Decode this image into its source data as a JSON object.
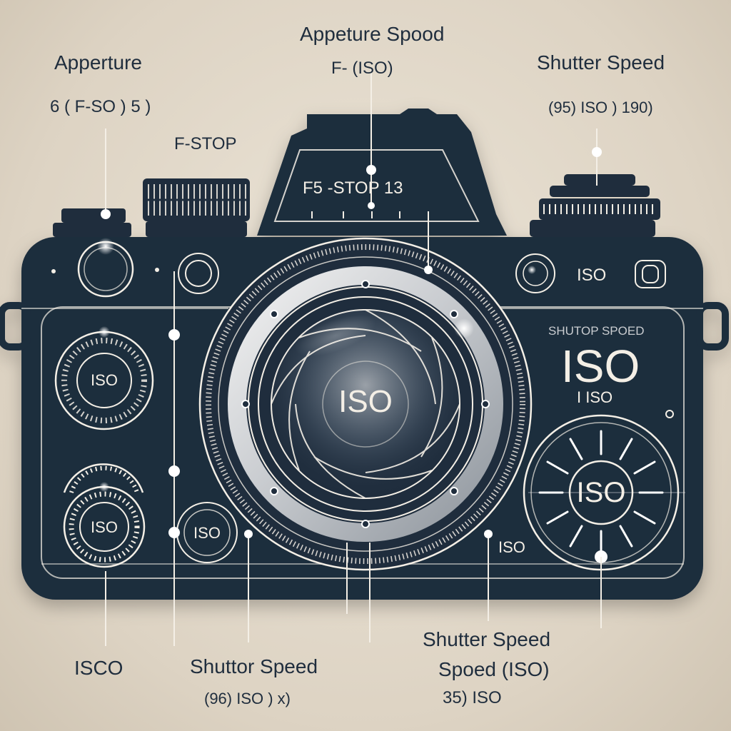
{
  "labels": {
    "aperture_title": "Apperture",
    "aperture_value": "6 ( F-SO ) 5 )",
    "fstop": "F-STOP",
    "top_title": "Appeture Spood",
    "top_sub": "F-   (ISO)",
    "shutter_title_tr": "Shutter Speed",
    "shutter_value_tr": "(95) ISO ) 190)",
    "prism_text": "F5 -STOP 13",
    "iso_right_small": "ISO",
    "right_panel_header": "SHUTOP SPOED",
    "right_panel_big": "ISO",
    "right_panel_sub": "I ISO",
    "left_dial_upper": "ISO",
    "left_dial_lower": "ISO",
    "small_dial": "ISO",
    "lens_center": "ISO",
    "right_dial": "ISO",
    "iso_near_lens": "ISO",
    "bottom_left": "ISCO",
    "bottom_mid_title": "Shuttor Speed",
    "bottom_mid_sub": "(96) ISO )   x)",
    "bottom_right_title": "Shutter Speed",
    "bottom_right_sub": "Spoed (ISO)",
    "bottom_right_sub2": "35) ISO"
  },
  "colors": {
    "body": "#1f2d3d",
    "line": "#f4efe6",
    "accent": "#ffffff",
    "background": "#e6dece"
  }
}
